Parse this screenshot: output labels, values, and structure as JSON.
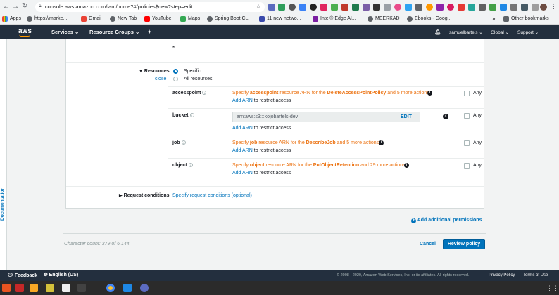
{
  "browser": {
    "url": "console.aws.amazon.com/iam/home?#/policies$new?step=edit",
    "bookmarks": [
      "Apps",
      "https://marke...",
      "Gmail",
      "New Tab",
      "YouTube",
      "Maps",
      "Spring Boot CLI",
      "11 new netwo...",
      "Intel® Edge AI...",
      "MEERKAD",
      "Ebooks - Goog..."
    ],
    "other_bookmarks": "Other bookmarks",
    "more": "»"
  },
  "aws_nav": {
    "logo": "aws",
    "services": "Services",
    "resource_groups": "Resource Groups",
    "user": "samuelbartels",
    "region": "Global",
    "support": "Support"
  },
  "side": {
    "documentation": "Documentation"
  },
  "editor": {
    "top_marker": "*",
    "resources_label": "Resources",
    "close_link": "close",
    "radio_specific": "Specific",
    "radio_all": "All resources",
    "any_label": "Any",
    "add_arn": "Add ARN",
    "restrict_suffix": "to restrict access",
    "rows": [
      {
        "name": "accesspoint",
        "pre": "Specify ",
        "resource": "accesspoint",
        "mid": " resource ARN for the ",
        "action": "DeleteAccessPointPolicy",
        "post": " and 5 more actions."
      },
      {
        "name": "bucket",
        "arn": "arn:aws:s3:::kojobartels-dev",
        "edit": "EDIT"
      },
      {
        "name": "job",
        "pre": "Specify ",
        "resource": "job",
        "mid": " resource ARN for the ",
        "action": "DescribeJob",
        "post": " and 5 more actions."
      },
      {
        "name": "object",
        "pre": "Specify ",
        "resource": "object",
        "mid": " resource ARN for the ",
        "action": "PutObjectRetention",
        "post": " and 29 more actions."
      }
    ],
    "request_conditions_label": "Request conditions",
    "request_conditions_link": "Specify request conditions (optional)",
    "add_permissions": "Add additional permissions",
    "char_count": "Character count: 379 of 6,144.",
    "cancel": "Cancel",
    "review": "Review policy"
  },
  "footer": {
    "feedback": "Feedback",
    "language": "English (US)",
    "copyright": "© 2008 - 2020, Amazon Web Services, Inc. or its affiliates. All rights reserved.",
    "privacy": "Privacy Policy",
    "terms": "Terms of Use"
  },
  "colors": {
    "nav": "#232f3e",
    "link": "#0073bb",
    "accent": "#ec7211",
    "primary_button": "#0073bb"
  }
}
